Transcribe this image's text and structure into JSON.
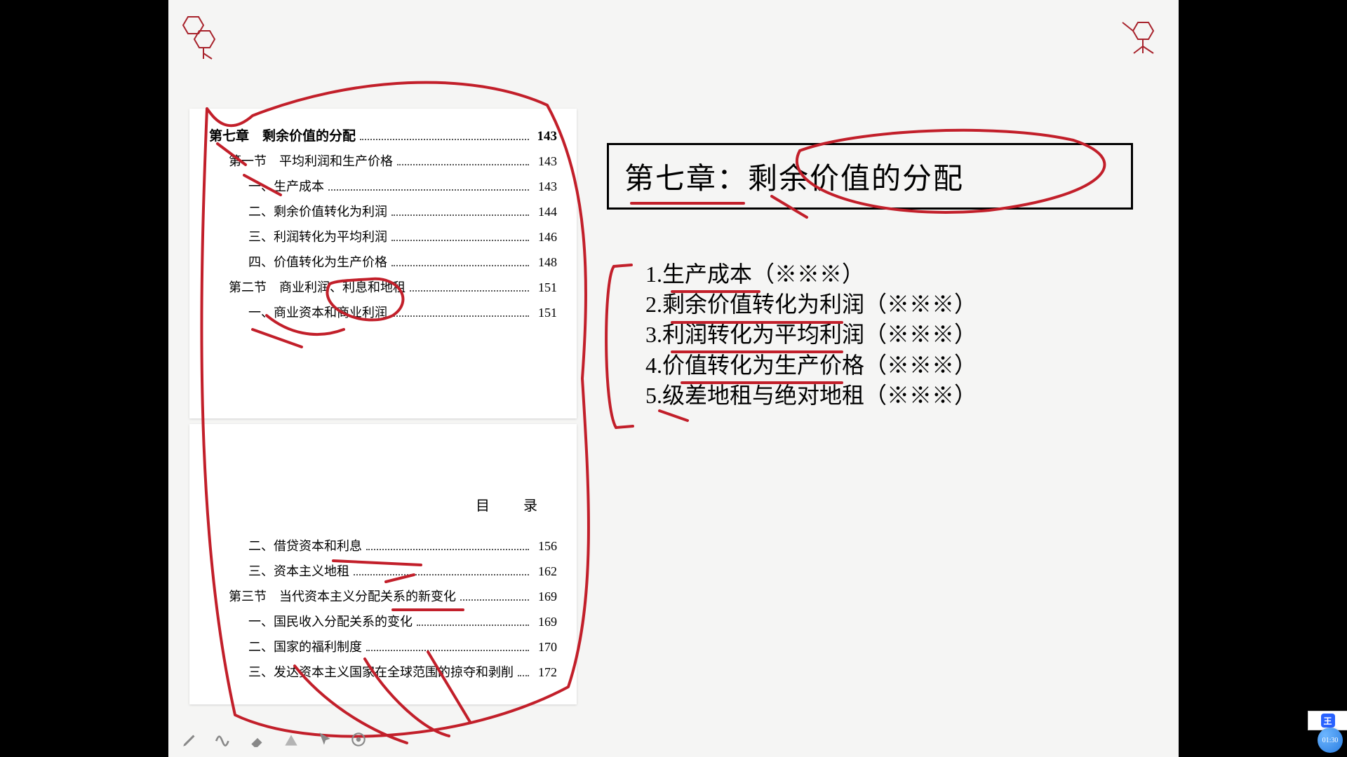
{
  "chapter_box": "第七章：剩余价值的分配",
  "outline": [
    "1.生产成本（※※※）",
    "2.剩余价值转化为利润（※※※）",
    "3.利润转化为平均利润（※※※）",
    "4.价值转化为生产价格（※※※）",
    "5.级差地租与绝对地租（※※※）"
  ],
  "toc_top": {
    "chapter": {
      "label": "第七章　剩余价值的分配",
      "page": "143"
    },
    "rows": [
      {
        "indent": "section",
        "label": "第一节　平均利润和生产价格",
        "page": "143"
      },
      {
        "indent": "item",
        "label": "一、生产成本",
        "page": "143"
      },
      {
        "indent": "item",
        "label": "二、剩余价值转化为利润",
        "page": "144"
      },
      {
        "indent": "item",
        "label": "三、利润转化为平均利润",
        "page": "146"
      },
      {
        "indent": "item",
        "label": "四、价值转化为生产价格",
        "page": "148"
      },
      {
        "indent": "section",
        "label": "第二节　商业利润、利息和地租",
        "page": "151"
      },
      {
        "indent": "item",
        "label": "一、商业资本和商业利润",
        "page": "151"
      }
    ]
  },
  "toc_bottom": {
    "mulu": "目　录",
    "rows": [
      {
        "indent": "item",
        "label": "二、借贷资本和利息",
        "page": "156"
      },
      {
        "indent": "item",
        "label": "三、资本主义地租",
        "page": "162"
      },
      {
        "indent": "section",
        "label": "第三节　当代资本主义分配关系的新变化",
        "page": "169"
      },
      {
        "indent": "item",
        "label": "一、国民收入分配关系的变化",
        "page": "169"
      },
      {
        "indent": "item",
        "label": "二、国家的福利制度",
        "page": "170"
      },
      {
        "indent": "item",
        "label": "三、发达资本主义国家在全球范围的掠夺和剥削",
        "page": "172"
      }
    ]
  },
  "timer": "01:30",
  "badge_glyph": "王",
  "colors": {
    "annotation": "#c21f2a",
    "hex_stroke": "#a8232c"
  }
}
